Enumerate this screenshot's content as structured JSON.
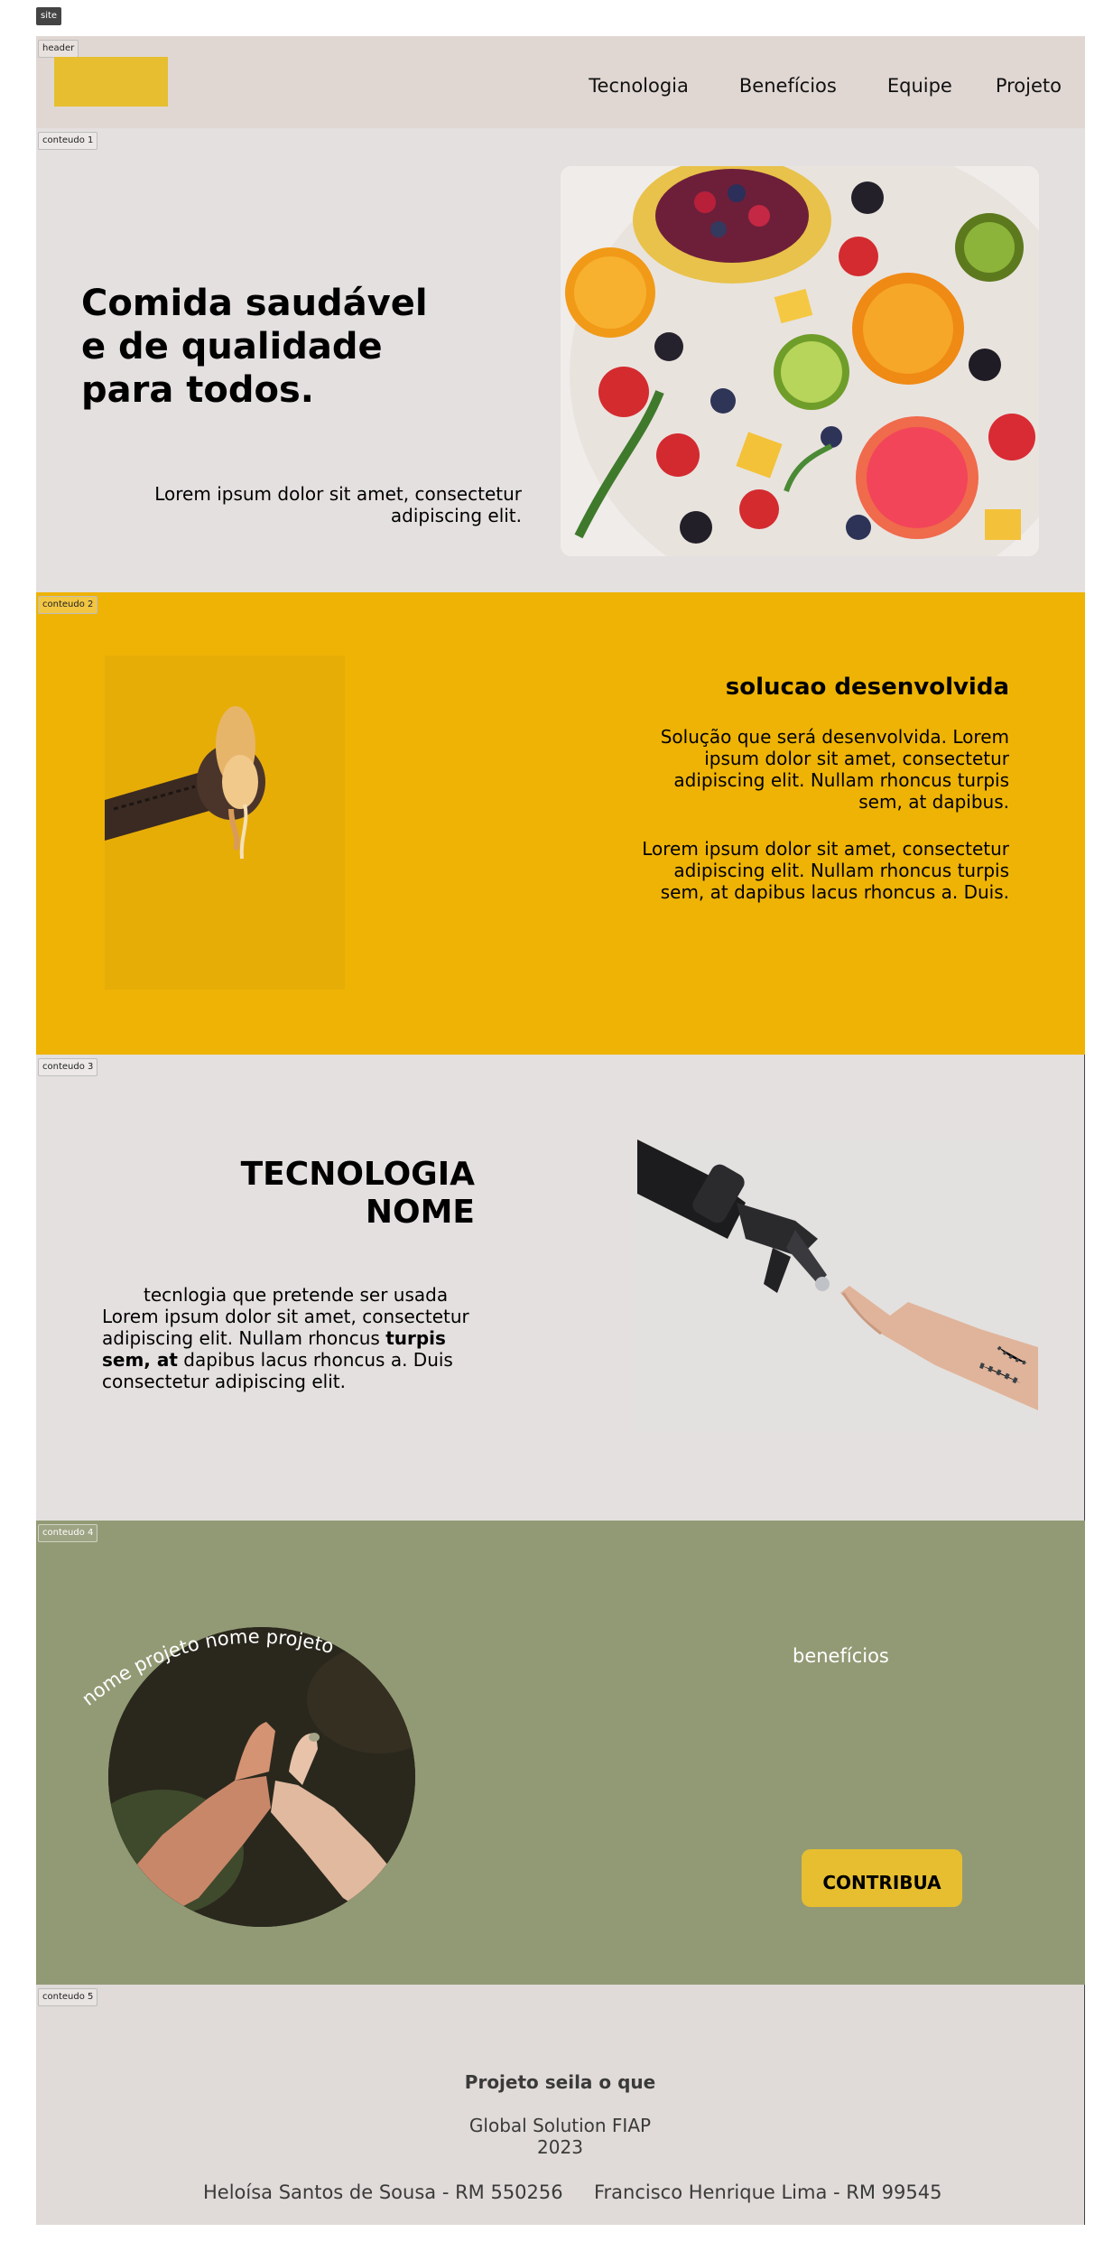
{
  "labels": {
    "site": "site",
    "header": "header",
    "conteudo1": "conteudo 1",
    "conteudo2": "conteudo 2",
    "conteudo3": "conteudo 3",
    "conteudo4": "conteudo 4",
    "conteudo5": "conteudo 5"
  },
  "header": {
    "nav": {
      "tecnologia": "Tecnologia",
      "beneficios": "Benefícios",
      "equipe": "Equipe",
      "projeto": "Projeto"
    },
    "logo_color": "#e6be2f",
    "background": "#e0d7d3"
  },
  "hero": {
    "title": "Comida saudável e de qualidade para todos.",
    "text": "Lorem ipsum dolor sit amet, consectetur adipiscing elit.",
    "image": "fruit-platter-photo"
  },
  "solution": {
    "heading": "solucao desenvolvida",
    "paragraph1": "Solução que será desenvolvida. Lorem ipsum dolor sit amet, consectetur adipiscing elit. Nullam rhoncus turpis sem, at dapibus.",
    "paragraph2": "Lorem ipsum dolor sit amet, consectetur adipiscing elit. Nullam rhoncus turpis sem, at dapibus lacus rhoncus a. Duis.",
    "image": "hand-squeezing-donut-photo",
    "background": "#eeb305"
  },
  "technology": {
    "title_line1": "TECNOLOGIA",
    "title_line2": "NOME",
    "text_intro": "tecnlogia que pretende ser usada",
    "text_body_a": "Lorem ipsum dolor sit amet, consectetur adipiscing elit. Nullam rhoncus ",
    "text_bold": "turpis sem, at",
    "text_body_b": " dapibus lacus rhoncus a. Duis consectetur adipiscing elit.",
    "image": "robot-hand-touching-human-hand-photo"
  },
  "benefits": {
    "curved_text": "nome projeto nome projeto",
    "label": "benefícios",
    "button": "CONTRIBUA",
    "image": "pinky-promise-hands-photo",
    "background": "#929a75",
    "button_color": "#e6be2f"
  },
  "footer": {
    "title": "Projeto seila o que",
    "subtitle_line1": "Global Solution FIAP",
    "subtitle_line2": "2023",
    "members": [
      "Heloísa Santos de Sousa - RM 550256",
      "Francisco Henrique Lima - RM 99545"
    ]
  }
}
